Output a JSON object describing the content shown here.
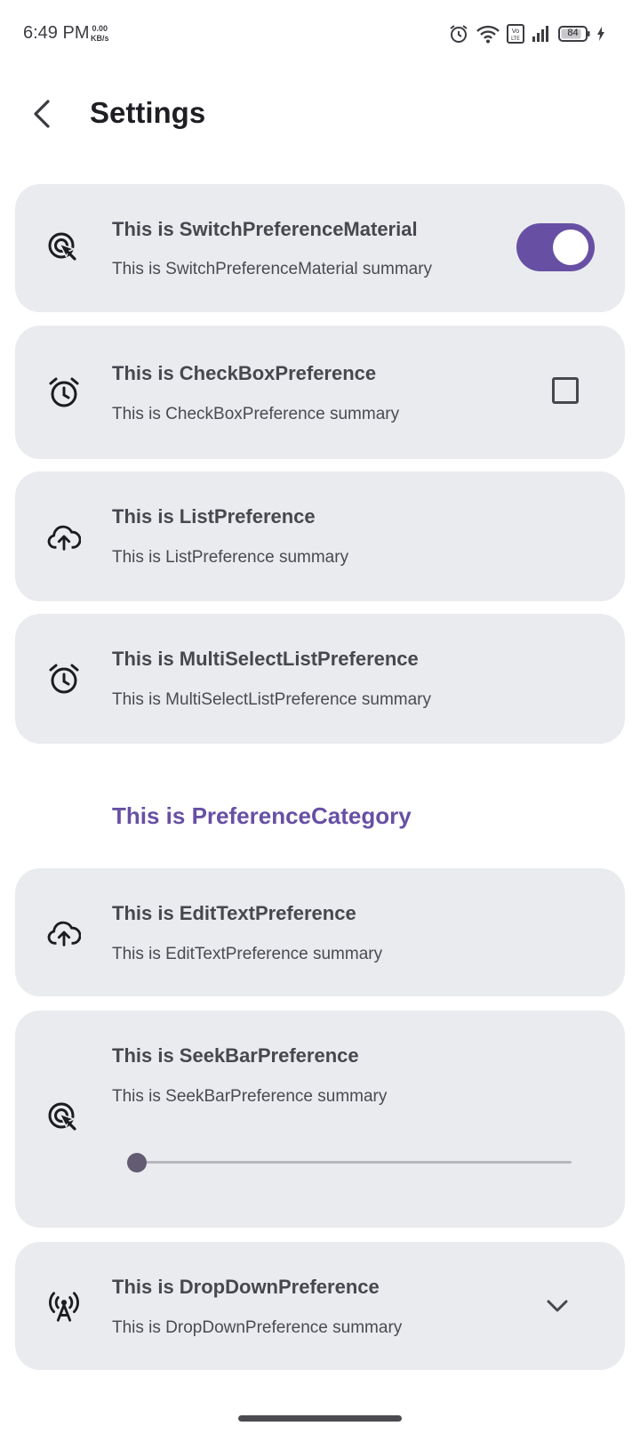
{
  "status_bar": {
    "time": "6:49 PM",
    "net_speed_value": "0.00",
    "net_speed_unit": "KB/s",
    "battery_level": "84",
    "icons": [
      "alarm-icon",
      "wifi-icon",
      "volte-icon",
      "signal-icon",
      "battery-icon",
      "charging-icon"
    ]
  },
  "app_bar": {
    "title": "Settings",
    "back_icon": "arrow-back-icon"
  },
  "preferences": [
    {
      "icon": "touch-click-icon",
      "title": "This is SwitchPreferenceMaterial",
      "summary": "This is SwitchPreferenceMaterial summary",
      "widget": "switch",
      "checked": true
    },
    {
      "icon": "alarm-clock-icon",
      "title": "This is CheckBoxPreference",
      "summary": "This is CheckBoxPreference summary",
      "widget": "checkbox",
      "checked": false
    },
    {
      "icon": "cloud-upload-icon",
      "title": "This is ListPreference",
      "summary": "This is ListPreference summary"
    },
    {
      "icon": "alarm-clock-icon",
      "title": "This is MultiSelectListPreference",
      "summary": "This is MultiSelectListPreference summary"
    }
  ],
  "category": {
    "title": "This is PreferenceCategory"
  },
  "category_preferences": [
    {
      "icon": "cloud-upload-icon",
      "title": "This is EditTextPreference",
      "summary": "This is EditTextPreference summary"
    },
    {
      "icon": "touch-click-icon",
      "title": "This is SeekBarPreference",
      "summary": "This is SeekBarPreference summary",
      "widget": "seekbar",
      "value_fraction": 0
    },
    {
      "icon": "antenna-icon",
      "title": "This is DropDownPreference",
      "summary": "This is DropDownPreference summary",
      "widget": "dropdown"
    }
  ],
  "colors": {
    "accent": "#6750a4",
    "card_background": "#eaebee",
    "title_text": "#47474f",
    "summary_text": "#4a4a52"
  }
}
